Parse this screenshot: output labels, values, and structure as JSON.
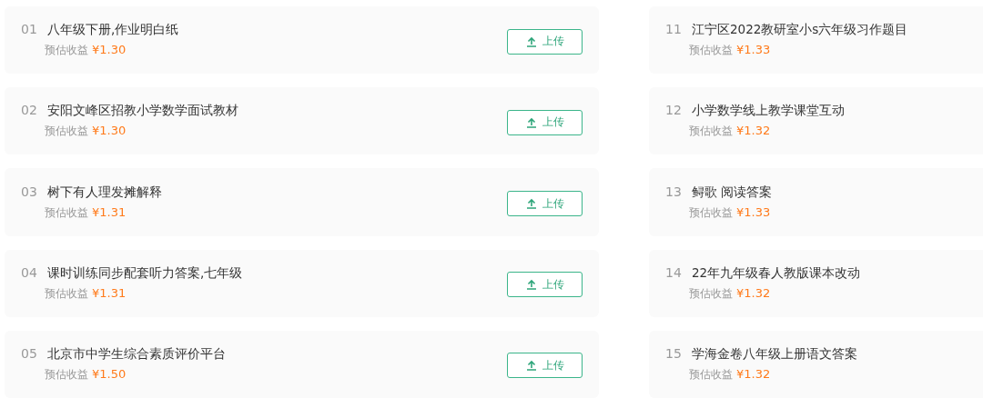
{
  "columns": [
    {
      "items": [
        {
          "number": "01",
          "title": "八年级下册,作业明白纸",
          "earnings_label": "预估收益",
          "earnings": "¥1.30",
          "button": "上传"
        },
        {
          "number": "02",
          "title": "安阳文峰区招教小学数学面试教材",
          "earnings_label": "预估收益",
          "earnings": "¥1.30",
          "button": "上传"
        },
        {
          "number": "03",
          "title": "树下有人理发摊解释",
          "earnings_label": "预估收益",
          "earnings": "¥1.31",
          "button": "上传"
        },
        {
          "number": "04",
          "title": "课时训练同步配套听力答案,七年级",
          "earnings_label": "预估收益",
          "earnings": "¥1.31",
          "button": "上传"
        },
        {
          "number": "05",
          "title": "北京市中学生综合素质评价平台",
          "earnings_label": "预估收益",
          "earnings": "¥1.50",
          "button": "上传"
        }
      ]
    },
    {
      "items": [
        {
          "number": "11",
          "title": "江宁区2022教研室小s六年级习作题目",
          "earnings_label": "预估收益",
          "earnings": "¥1.33"
        },
        {
          "number": "12",
          "title": "小学数学线上教学课堂互动",
          "earnings_label": "预估收益",
          "earnings": "¥1.32"
        },
        {
          "number": "13",
          "title": "鲟歌 阅读答案",
          "earnings_label": "预估收益",
          "earnings": "¥1.33"
        },
        {
          "number": "14",
          "title": "22年九年级春人教版课本改动",
          "earnings_label": "预估收益",
          "earnings": "¥1.32"
        },
        {
          "number": "15",
          "title": "学海金卷八年级上册语文答案",
          "earnings_label": "预估收益",
          "earnings": "¥1.32"
        }
      ]
    }
  ]
}
